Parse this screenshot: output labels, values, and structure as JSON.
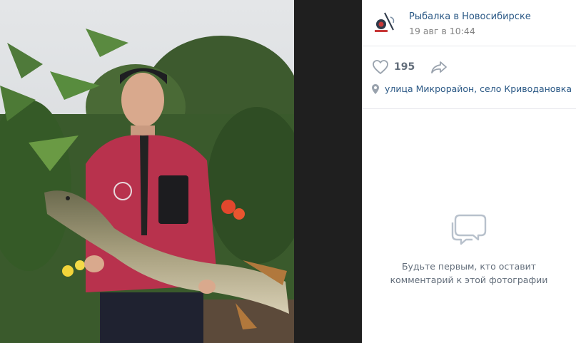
{
  "post": {
    "group_name": "Рыбалка в Новосибирске",
    "date": "19 авг в 10:44",
    "likes": "195",
    "location": "улица Микрорайон, село Криводановка"
  },
  "comments": {
    "empty_line1": "Будьте первым, кто оставит",
    "empty_line2": "комментарий к этой фотографии"
  },
  "icons": {
    "like": "heart-icon",
    "share": "share-arrow-icon",
    "location": "map-pin-icon",
    "comments": "speech-bubbles-icon"
  },
  "colors": {
    "link": "#2a5885",
    "secondary": "#828282",
    "icon": "#b8c1cc"
  }
}
